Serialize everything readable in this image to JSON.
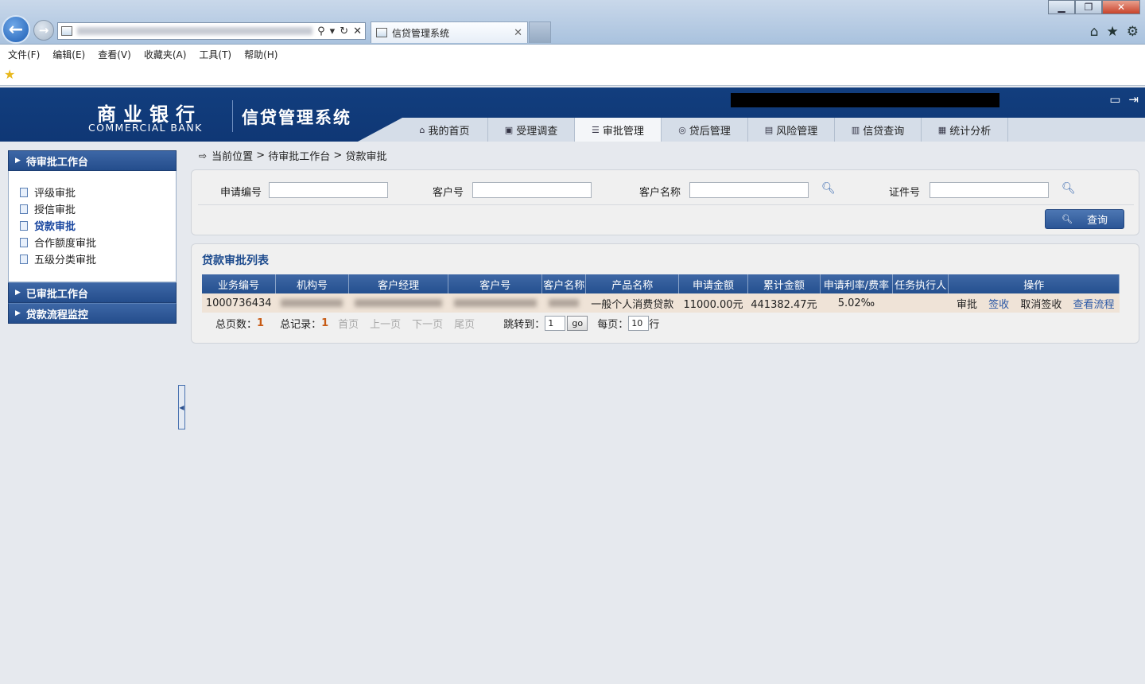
{
  "browser": {
    "tab_title": "信贷管理系统",
    "address_url": "http://10.0.x.x/...",
    "menu": [
      "文件(F)",
      "编辑(E)",
      "查看(V)",
      "收藏夹(A)",
      "工具(T)",
      "帮助(H)"
    ]
  },
  "header": {
    "bank_name_cn": "商业银行",
    "bank_name_en": "COMMERCIAL BANK",
    "system_title": "信贷管理系统",
    "nav": [
      {
        "label": "我的首页",
        "icon": "home-icon"
      },
      {
        "label": "受理调查",
        "icon": "survey-icon"
      },
      {
        "label": "审批管理",
        "icon": "approval-icon"
      },
      {
        "label": "贷后管理",
        "icon": "postloan-icon"
      },
      {
        "label": "风险管理",
        "icon": "risk-icon"
      },
      {
        "label": "信贷查询",
        "icon": "query-icon"
      },
      {
        "label": "统计分析",
        "icon": "stats-icon"
      }
    ],
    "active_nav": "审批管理"
  },
  "sidebar": {
    "sections": [
      {
        "title": "待审批工作台",
        "expanded": true,
        "items": [
          "评级审批",
          "授信审批",
          "贷款审批",
          "合作额度审批",
          "五级分类审批"
        ],
        "active": "贷款审批"
      },
      {
        "title": "已审批工作台",
        "expanded": false
      },
      {
        "title": "贷款流程监控",
        "expanded": false
      }
    ]
  },
  "breadcrumb": {
    "prefix": "当前位置",
    "sep": ">",
    "path": [
      "待审批工作台",
      "贷款审批"
    ]
  },
  "search": {
    "fields": [
      "申请编号",
      "客户号",
      "客户名称",
      "证件号"
    ],
    "values": [
      "",
      "",
      "",
      ""
    ],
    "button": "查询"
  },
  "list": {
    "title": "贷款审批列表",
    "columns": [
      "业务编号",
      "机构号",
      "客户经理",
      "客户号",
      "客户名称",
      "产品名称",
      "申请金额",
      "累计金额",
      "申请利率/费率",
      "任务执行人",
      "操作"
    ],
    "rows": [
      {
        "business_no": "1000736434",
        "org_no": "",
        "manager": "",
        "customer_no": "",
        "customer_name": "",
        "product": "一般个人消费贷款",
        "apply_amount": "11000.00元",
        "total_amount": "441382.47元",
        "rate": "5.02‰",
        "executor": "",
        "actions": [
          "审批",
          "签收",
          "取消签收",
          "查看流程"
        ]
      }
    ]
  },
  "pager": {
    "total_pages_label": "总页数：",
    "total_pages": "1",
    "total_records_label": "总记录：",
    "total_records": "1",
    "first": "首页",
    "prev": "上一页",
    "next": "下一页",
    "last": "尾页",
    "jump_label": "跳转到：",
    "jump_value": "1",
    "go": "go",
    "per_page_label": "每页：",
    "per_page": "10",
    "rows_unit": "行"
  },
  "colors": {
    "header_blue": "#123e7e",
    "sidebar_head": "#2f5a99",
    "table_head": "#2f5a99",
    "row_bg": "#efe3d7",
    "link": "#2b58a6",
    "pager_num": "#c75b15"
  }
}
